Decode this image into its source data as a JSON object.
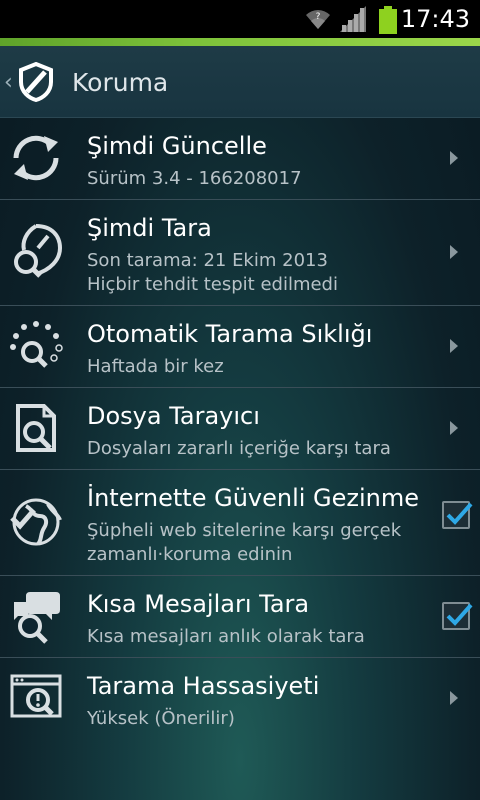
{
  "status_bar": {
    "time": "17:43"
  },
  "action_bar": {
    "back": "‹",
    "title": "Koruma"
  },
  "items": [
    {
      "title": "Şimdi Güncelle",
      "subtitle": "Sürüm 3.4 - 166208017",
      "control": "chevron"
    },
    {
      "title": "Şimdi Tara",
      "subtitle": "Son tarama: 21 Ekim 2013",
      "subtitle2": "Hiçbir tehdit tespit edilmedi",
      "control": "chevron"
    },
    {
      "title": "Otomatik Tarama Sıklığı",
      "subtitle": "Haftada bir kez",
      "control": "chevron"
    },
    {
      "title": "Dosya Tarayıcı",
      "subtitle": "Dosyaları zararlı içeriğe karşı tara",
      "control": "chevron"
    },
    {
      "title": "İnternette Güvenli Gezinme",
      "subtitle": "Şüpheli web sitelerine karşı gerçek",
      "subtitle2": "zamanlı·koruma edinin",
      "control": "checkbox",
      "checked": true
    },
    {
      "title": "Kısa Mesajları Tara",
      "subtitle": "Kısa mesajları anlık olarak tara",
      "control": "checkbox",
      "checked": true
    },
    {
      "title": "Tarama Hassasiyeti",
      "subtitle": "Yüksek (Önerilir)",
      "control": "chevron"
    }
  ],
  "colors": {
    "accent_green": "#7dc23a",
    "battery_green": "#8ed11f",
    "check_blue": "#2ea8e6"
  },
  "icons": [
    "update-icon",
    "scan-icon",
    "auto-scan-icon",
    "file-scanner-icon",
    "web-protection-icon",
    "sms-scan-icon",
    "scan-sensitivity-icon"
  ]
}
